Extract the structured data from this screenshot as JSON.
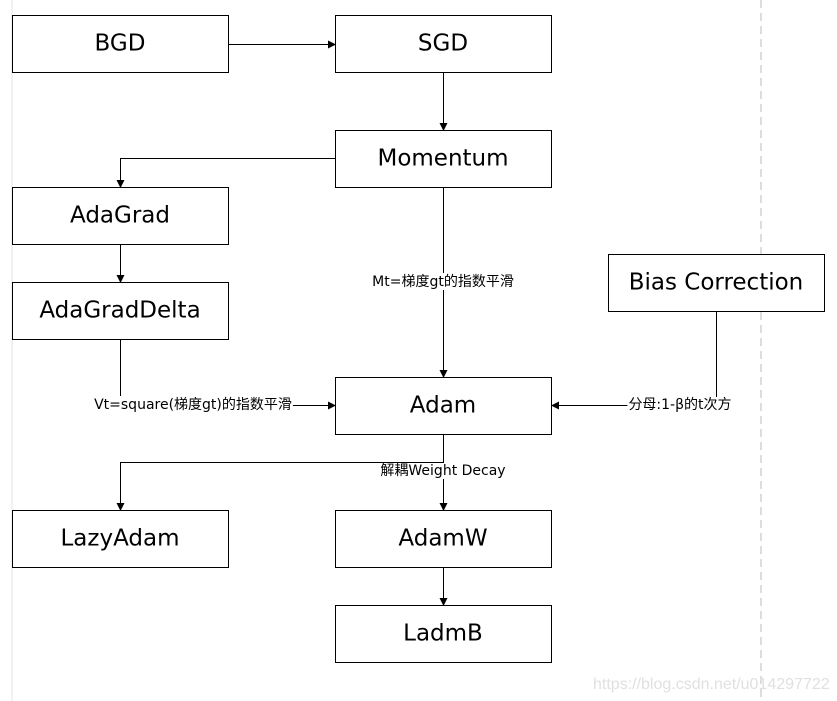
{
  "nodes": {
    "bgd": "BGD",
    "sgd": "SGD",
    "momentum": "Momentum",
    "adagrad": "AdaGrad",
    "adagraddelta": "AdaGradDelta",
    "bias": "Bias Correction",
    "adam": "Adam",
    "lazyadam": "LazyAdam",
    "adamw": "AdamW",
    "ladmb": "LadmB"
  },
  "edge_labels": {
    "mt": "Mt=梯度gt的指数平滑",
    "vt": "Vt=square(梯度gt)的指数平滑",
    "bias": "分母:1-β的t次方",
    "decay": "解耦Weight Decay"
  },
  "watermark": "https://blog.csdn.net/u014297722"
}
